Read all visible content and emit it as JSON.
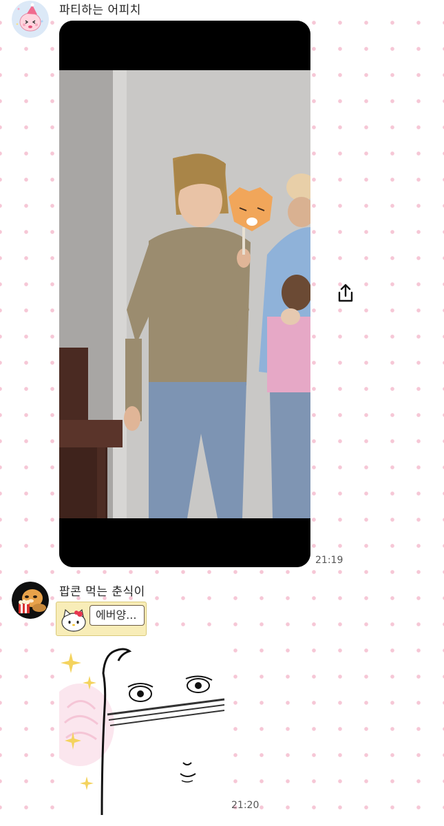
{
  "messages": [
    {
      "sender": "파티하는 어피치",
      "avatar_icon": "party-apeach-icon",
      "attachment": "video",
      "action_icon": "share-icon",
      "time": "21:19"
    },
    {
      "sender": "팝콘 먹는 춘식이",
      "avatar_icon": "popcorn-choonsik-icon",
      "emoticon_text": "에버양...",
      "attachment": "sticker",
      "time": "21:20"
    }
  ],
  "colors": {
    "dot_pattern": "#f6c7d6",
    "emoticon_background": "#f8edb8"
  }
}
